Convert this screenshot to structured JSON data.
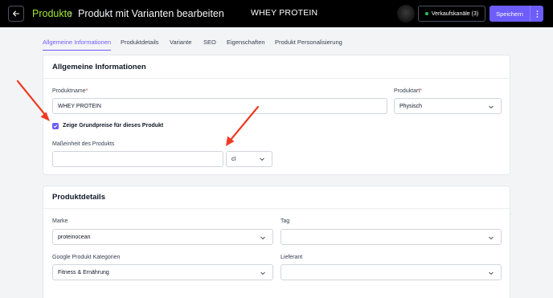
{
  "header": {
    "breadcrumb_root": "Produkte",
    "breadcrumb_separator": "›",
    "breadcrumb_page": "Produkt mit Varianten bearbeiten",
    "product_name": "WHEY PROTEIN",
    "sales_channels_label": "Verkaufskanäle (3)",
    "save_label": "Speichern",
    "more_label": "⋮"
  },
  "tabs": [
    {
      "label": "Allgemeine Informationen",
      "active": true
    },
    {
      "label": "Produktdetails"
    },
    {
      "label": "Variante"
    },
    {
      "label": "SEO"
    },
    {
      "label": "Eigenschaften"
    },
    {
      "label": "Produkt Personalisierung"
    }
  ],
  "general": {
    "title": "Allgemeine Informationen",
    "product_name_label": "Produktname",
    "product_name_value": "WHEY PROTEIN",
    "product_type_label": "Produktart",
    "product_type_value": "Physisch",
    "required_marker": "*",
    "base_price_checkbox_label": "Zeige Grundpreise für dieses Produkt",
    "base_price_checked": true,
    "unit_label": "Maßeinheit des Produkts",
    "unit_amount_value": "",
    "unit_value": "cl"
  },
  "details": {
    "title": "Produktdetails",
    "brand_label": "Marke",
    "brand_value": "proteinocean",
    "tag_label": "Tag",
    "tag_value": "",
    "google_category_label": "Google Produkt Kategorien",
    "google_category_value": "Fitness & Ernährung",
    "supplier_label": "Lieferant",
    "supplier_value": ""
  },
  "colors": {
    "accent": "#6d5dfc",
    "breadcrumb_root": "#a3e635",
    "annotation_arrow": "#ef3b24",
    "online_dot": "#22c55e"
  },
  "icons": [
    "back-arrow-icon",
    "dot-icon",
    "more-vertical-icon",
    "chevron-down-icon",
    "checkmark-icon"
  ]
}
